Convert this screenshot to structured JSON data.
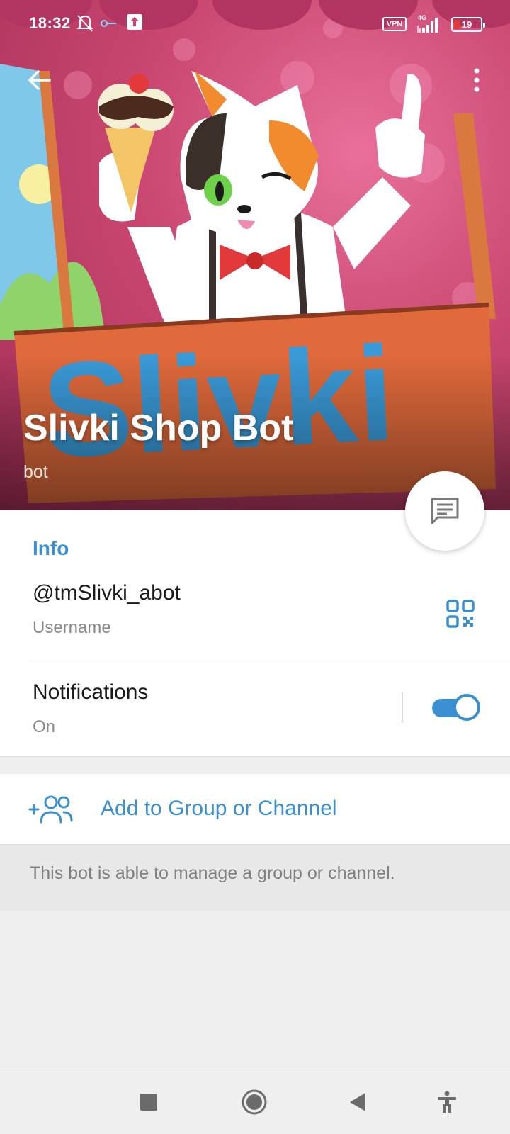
{
  "status_bar": {
    "time": "18:32",
    "vpn": "VPN",
    "network": "4G",
    "battery": "19",
    "icons": [
      "bell-off-icon",
      "key-icon",
      "upload-icon",
      "signal-icon",
      "battery-icon"
    ]
  },
  "toolbar": {
    "back_icon": "arrow-left-icon",
    "more_icon": "more-vertical-icon"
  },
  "profile": {
    "name": "Slivki Shop Bot",
    "subtitle": "bot",
    "fab_icon": "message-icon",
    "banner_text": "Slivki"
  },
  "info": {
    "section_title": "Info",
    "username": "@tmSlivki_abot",
    "username_caption": "Username",
    "qr_icon": "qr-code-icon",
    "notifications_title": "Notifications",
    "notifications_state": "On",
    "notifications_enabled": true
  },
  "actions": {
    "add_to_group_label": "Add to Group or Channel",
    "add_to_group_icon": "add-users-icon",
    "hint": "This bot is able to manage a group or channel."
  },
  "colors": {
    "accent": "#3a8fd0",
    "hero": "#c8466f",
    "background": "#efefef"
  },
  "nav": {
    "icons": [
      "recents-square-icon",
      "home-circle-icon",
      "back-triangle-icon",
      "accessibility-icon"
    ]
  }
}
